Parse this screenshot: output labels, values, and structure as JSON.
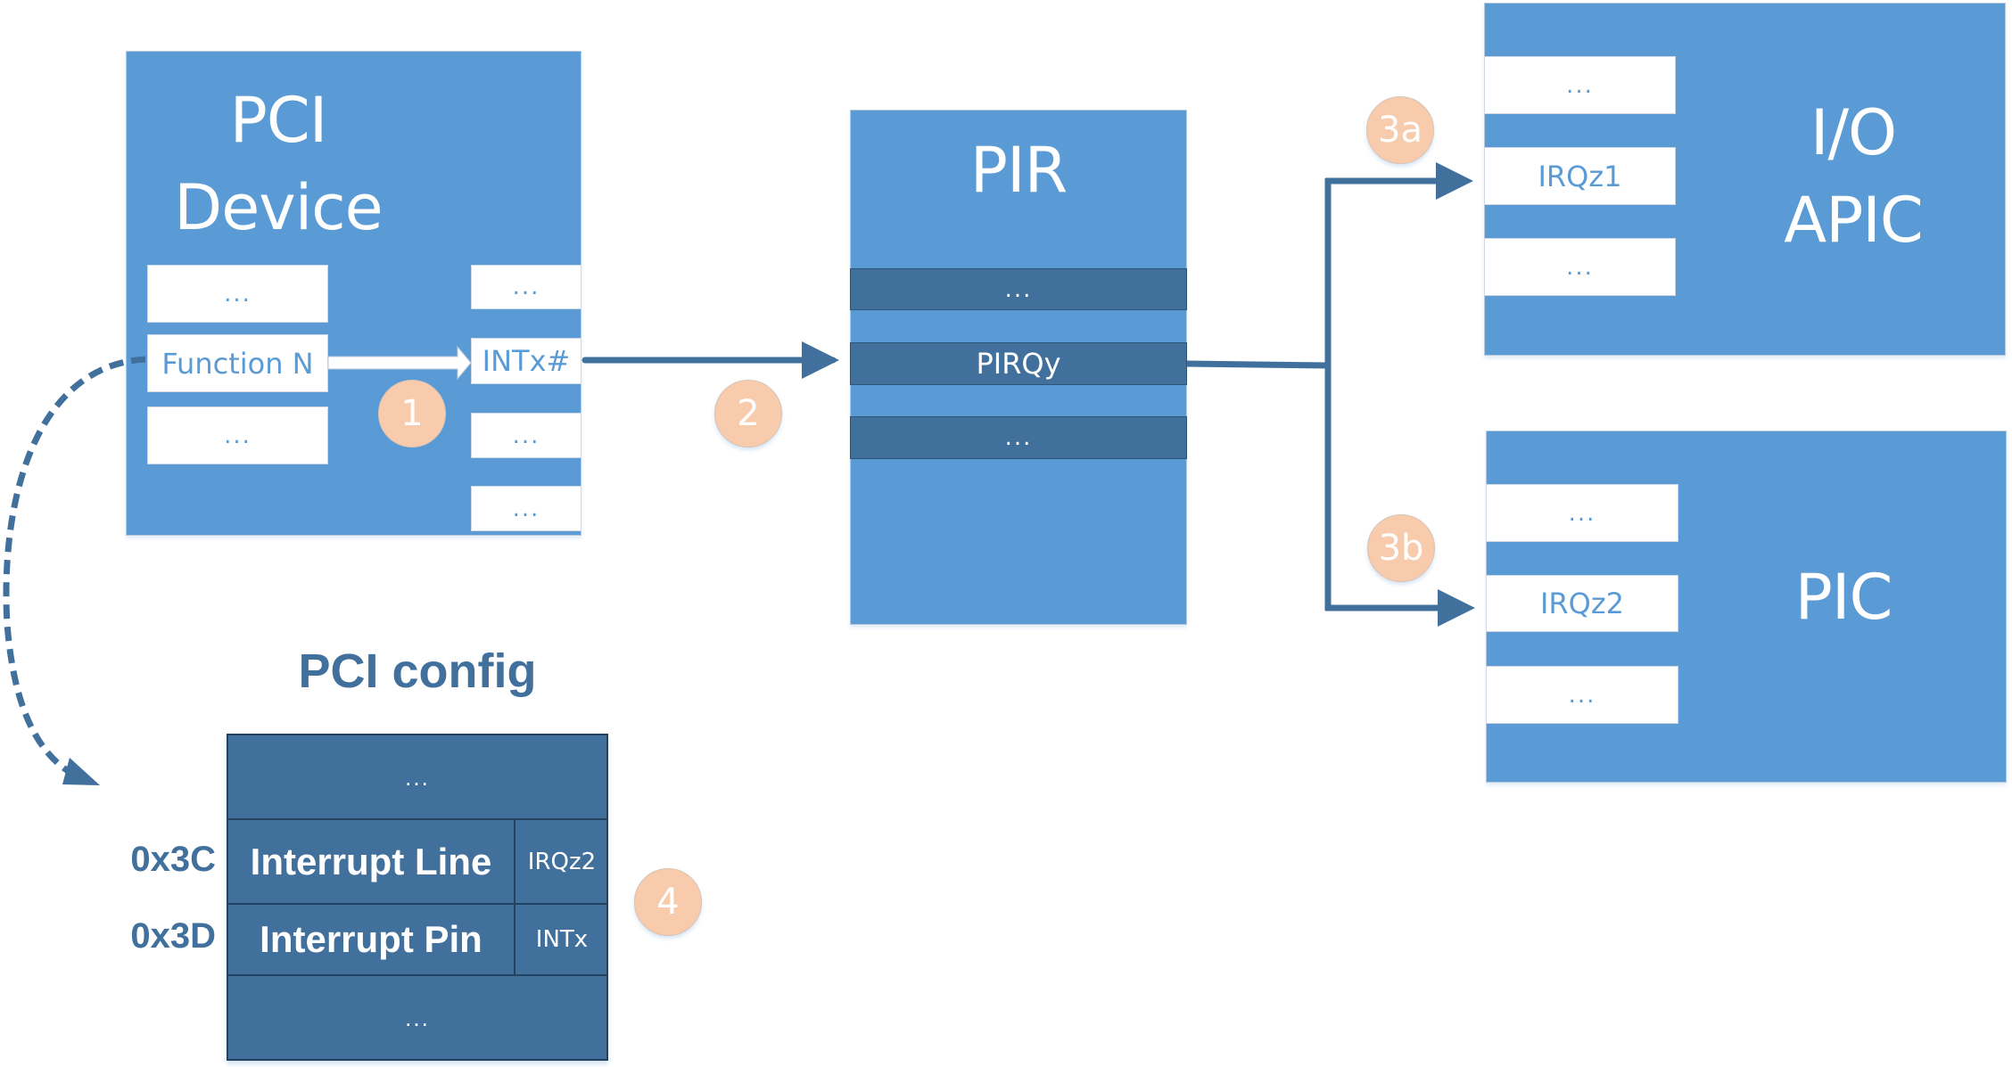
{
  "pci_device": {
    "title_line1": "PCI",
    "title_line2": "Device",
    "functions": [
      "...",
      "Function N",
      "..."
    ],
    "pins": [
      "...",
      "INTx#",
      "...",
      "..."
    ]
  },
  "pir": {
    "title": "PIR",
    "entries": [
      "...",
      "PIRQy",
      "..."
    ]
  },
  "io_apic": {
    "title_line1": "I/O",
    "title_line2": "APIC",
    "inputs": [
      "...",
      "IRQz1",
      "..."
    ]
  },
  "pic": {
    "title": "PIC",
    "inputs": [
      "...",
      "IRQz2",
      "..."
    ]
  },
  "pci_config": {
    "title": "PCI config",
    "top_row": "...",
    "bottom_row": "...",
    "registers": [
      {
        "offset": "0x3C",
        "name": "Interrupt Line",
        "value": "IRQz2"
      },
      {
        "offset": "0x3D",
        "name": "Interrupt Pin",
        "value": "INTx"
      }
    ]
  },
  "steps": {
    "s1": "1",
    "s2": "2",
    "s3a": "3a",
    "s3b": "3b",
    "s4": "4"
  },
  "colors": {
    "block_blue": "#5b9bd5",
    "dark_blue": "#41709c",
    "badge_peach": "#f7cbac",
    "arrow": "#41709c"
  }
}
